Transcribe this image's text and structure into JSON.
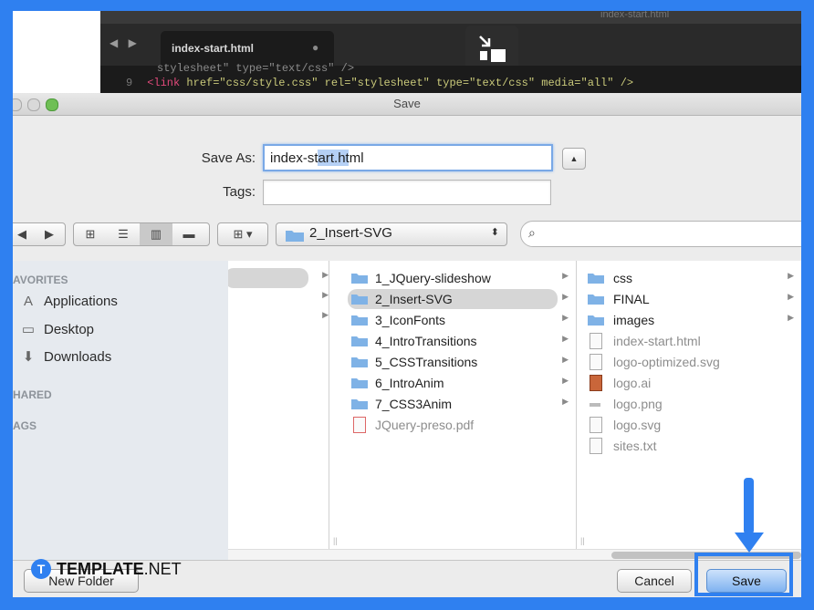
{
  "editor": {
    "window_title": "index-start.html",
    "tab_label": "index-start.html",
    "tab_dirty_marker": "●",
    "nav_arrows": "◀ ▶",
    "code_line_top": "stylesheet\" type=\"text/css\" />",
    "code_line_num": "9",
    "code_line_tag": "<link",
    "code_line_rest": " href=\"css/style.css\" rel=\"stylesheet\" type=\"text/css\" media=\"all\" />"
  },
  "dialog": {
    "title": "Save",
    "save_as_label": "Save As:",
    "save_as_value": "index-start.html",
    "tags_label": "Tags:",
    "tags_value": "",
    "expand_glyph": "▲"
  },
  "toolbar": {
    "back": "◀",
    "forward": "▶",
    "view_icon": "⊞",
    "view_list": "☰",
    "view_columns": "▥",
    "view_coverflow": "▬",
    "arrange": "⊞ ▾",
    "location": "2_Insert-SVG",
    "location_arrows": "⬍",
    "search_placeholder": "",
    "search_glyph": "⌕"
  },
  "sidebar": {
    "favorites_header": "AVORITES",
    "shared_header": "HARED",
    "tags_header": "AGS",
    "items": [
      {
        "label": "Applications",
        "icon": "applications-icon",
        "glyph": "A"
      },
      {
        "label": "Desktop",
        "icon": "desktop-icon",
        "glyph": "▭"
      },
      {
        "label": "Downloads",
        "icon": "downloads-icon",
        "glyph": "⬇"
      }
    ]
  },
  "column2": {
    "items": [
      {
        "label": "1_JQuery-slideshow",
        "type": "folder",
        "selected": false
      },
      {
        "label": "2_Insert-SVG",
        "type": "folder",
        "selected": true
      },
      {
        "label": "3_IconFonts",
        "type": "folder",
        "selected": false
      },
      {
        "label": "4_IntroTransitions",
        "type": "folder",
        "selected": false
      },
      {
        "label": "5_CSSTransitions",
        "type": "folder",
        "selected": false
      },
      {
        "label": "6_IntroAnim",
        "type": "folder",
        "selected": false
      },
      {
        "label": "7_CSS3Anim",
        "type": "folder",
        "selected": false
      },
      {
        "label": "JQuery-preso.pdf",
        "type": "file",
        "selected": false
      }
    ]
  },
  "column3": {
    "items": [
      {
        "label": "css",
        "type": "folder"
      },
      {
        "label": "FINAL",
        "type": "folder"
      },
      {
        "label": "images",
        "type": "folder"
      },
      {
        "label": "index-start.html",
        "type": "file"
      },
      {
        "label": "logo-optimized.svg",
        "type": "file"
      },
      {
        "label": "logo.ai",
        "type": "file"
      },
      {
        "label": "logo.png",
        "type": "file"
      },
      {
        "label": "logo.svg",
        "type": "file"
      },
      {
        "label": "sites.txt",
        "type": "file"
      }
    ]
  },
  "footer": {
    "new_folder": "New Folder",
    "cancel": "Cancel",
    "save": "Save"
  },
  "branding": {
    "badge": "T",
    "name_bold": "TEMPLATE",
    "name_suffix": ".NET"
  },
  "colors": {
    "frame": "#2f80f0",
    "folder": "#7fb2e6",
    "selection": "#d6d6d6"
  }
}
